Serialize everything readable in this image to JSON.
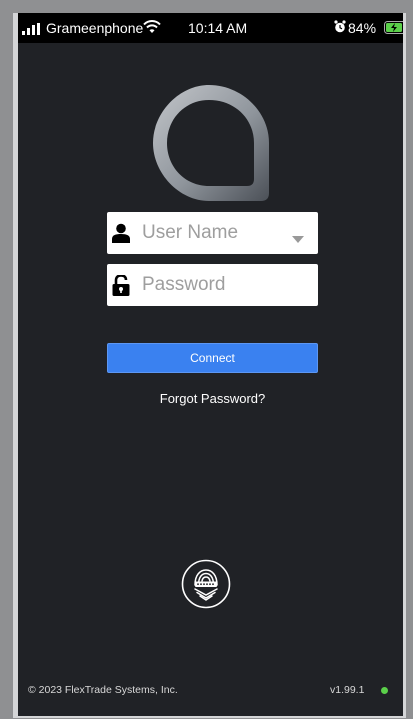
{
  "status_bar": {
    "carrier": "Grameenphone",
    "time": "10:14 AM",
    "battery_percent": "84%",
    "signal_icon": "signal-bars-icon",
    "wifi_icon": "wifi-icon",
    "alarm_icon": "alarm-clock-icon",
    "battery_icon": "battery-charging-icon",
    "battery_color": "#5bd04a"
  },
  "login": {
    "logo_icon": "app-logo-icon",
    "username": {
      "placeholder": "User Name",
      "value": "",
      "icon": "user-icon",
      "dropdown_icon": "caret-down-icon"
    },
    "password": {
      "placeholder": "Password",
      "value": "",
      "icon": "lock-icon"
    },
    "connect_label": "Connect",
    "forgot_label": "Forgot Password?",
    "fingerprint_icon": "fingerprint-icon",
    "accent_color": "#3a81f0"
  },
  "footer": {
    "copyright": "© 2023 FlexTrade Systems, Inc.",
    "version": "v1.99.1",
    "status_color": "#5bd04a"
  },
  "colors": {
    "background": "#202226",
    "status_bar": "#000000"
  }
}
